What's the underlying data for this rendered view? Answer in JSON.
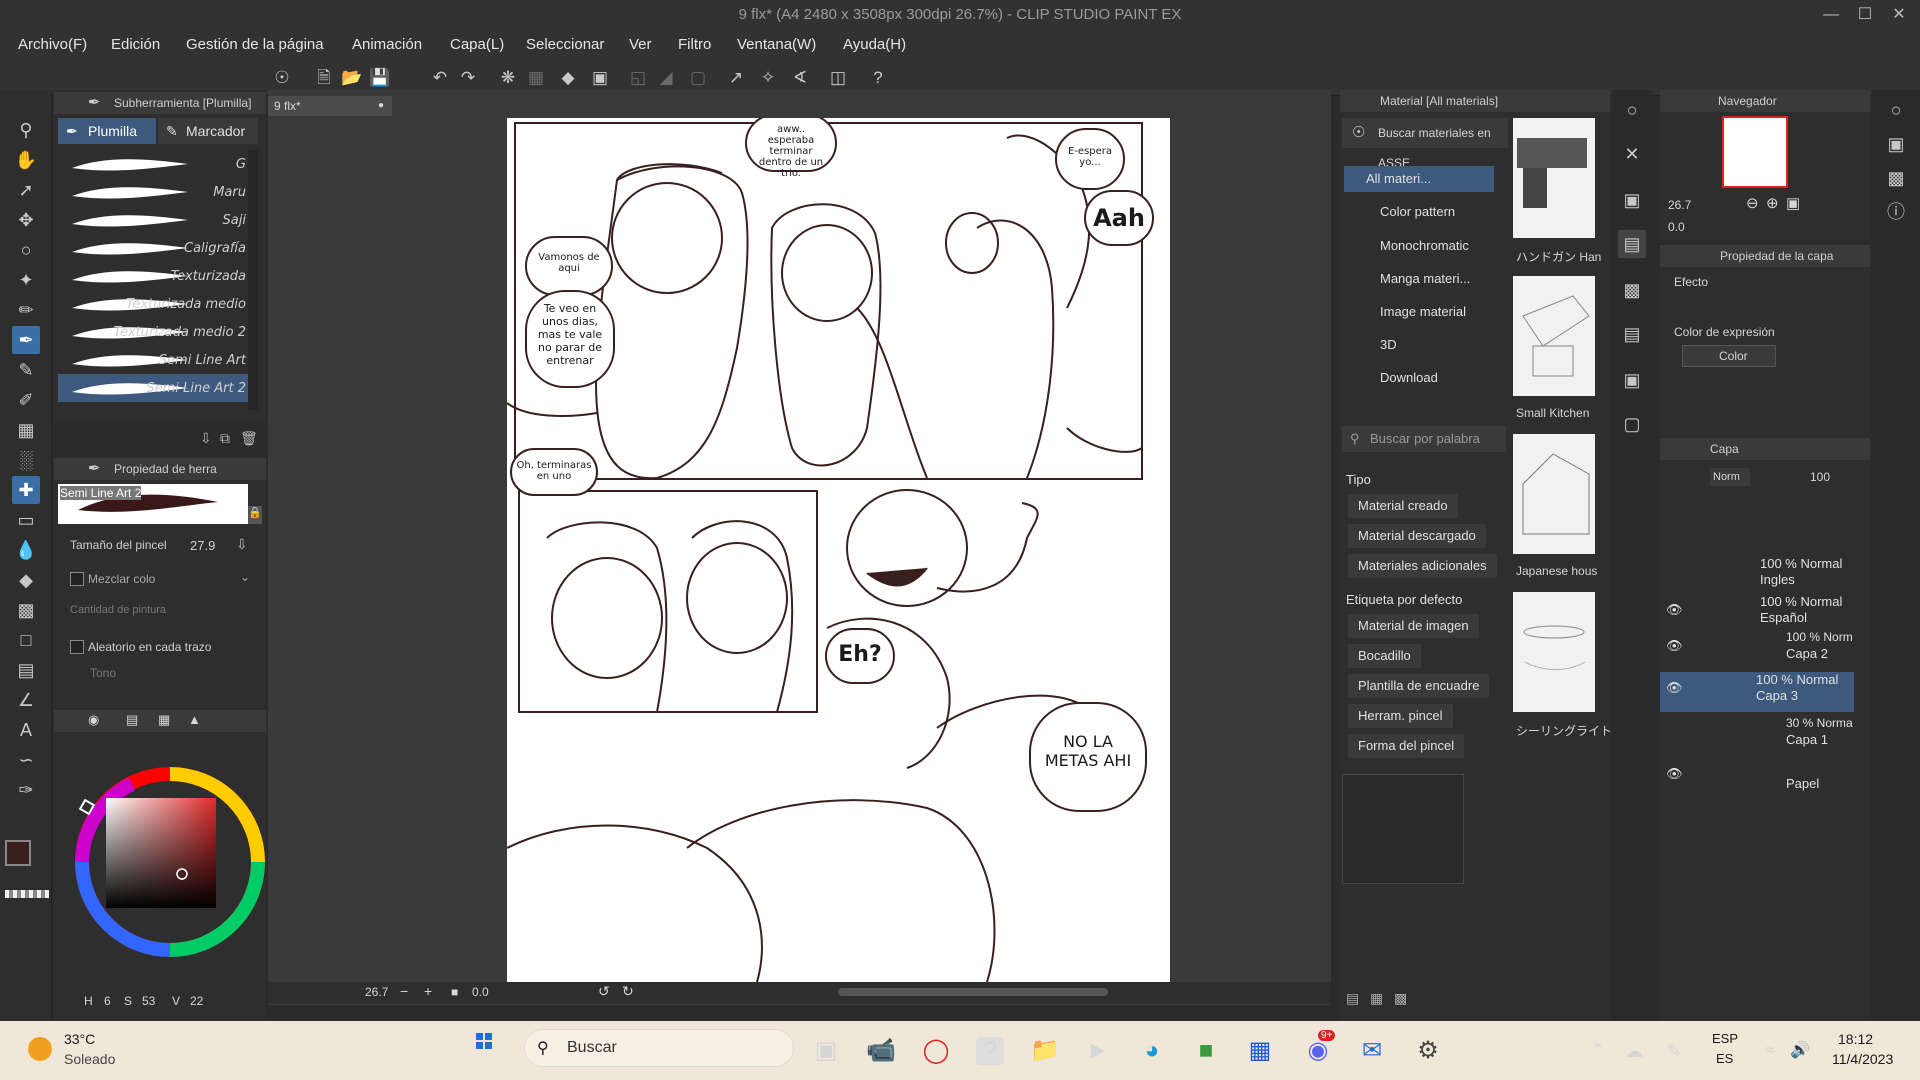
{
  "window": {
    "title": "9 flx* (A4 2480 x 3508px 300dpi 26.7%) - CLIP STUDIO PAINT EX"
  },
  "menu": [
    "Archivo(F)",
    "Edición",
    "Gestión de la página",
    "Animación",
    "Capa(L)",
    "Seleccionar",
    "Ver",
    "Filtro",
    "Ventana(W)",
    "Ayuda(H)"
  ],
  "subtool": {
    "title": "Subherramienta [Plumilla]",
    "tabs": [
      "Plumilla",
      "Marcador"
    ],
    "brushes": [
      "G",
      "Maru",
      "Saji",
      "Caligrafía",
      "Texturizada",
      "Texturizada medio",
      "Texturizada medio 2",
      "Semi Line Art",
      "Semi Line Art 2"
    ]
  },
  "toolprop": {
    "title": "Propiedad de herra",
    "preview_name": "Semi Line Art 2",
    "size_label": "Tamaño del pincel",
    "size_value": "27.9",
    "mix_label": "Mezclar colo",
    "paint_label": "Cantidad de pintura",
    "random_label": "Aleatorio en cada trazo",
    "tone_label": "Tono"
  },
  "color_footer": {
    "h": "H",
    "h_val": "6",
    "s": "S",
    "s_val": "53",
    "v": "V",
    "v_val": "22"
  },
  "document": {
    "tab": "9 flx*"
  },
  "comic": {
    "b1": "aww.. esperaba terminar dentro de un trio.",
    "b2": "E-espera yo...",
    "b3": "Aah",
    "b4": "Vamonos de aqui",
    "b5": "Te veo en unos dias, mas te vale no parar de entrenar",
    "b6": "Oh, terminaras en uno",
    "b7": "Eh?",
    "b8": "NO LA METAS AHI"
  },
  "canvas_status": {
    "zoom": "26.7",
    "angle": "0.0"
  },
  "material": {
    "title": "Material [All materials]",
    "search_assets": "Buscar materiales en ASSE",
    "tree": [
      "All materi...",
      "Color pattern",
      "Monochromatic",
      "Manga materi...",
      "Image material",
      "3D",
      "Download"
    ],
    "search_placeholder": "Buscar por palabra",
    "type_label": "Tipo",
    "types": [
      "Material creado",
      "Material descargado",
      "Materiales adicionales"
    ],
    "tag_label": "Etiqueta por defecto",
    "tags": [
      "Material de imagen",
      "Bocadillo",
      "Plantilla de encuadre",
      "Herram. pincel",
      "Forma del pincel"
    ],
    "thumbs": [
      "ハンドガン Han",
      "Small Kitchen",
      "Japanese hous",
      "シーリングライト"
    ]
  },
  "navigator": {
    "title": "Navegador",
    "zoom": "26.7",
    "angle": "0.0"
  },
  "layer_prop": {
    "title": "Propiedad de la capa",
    "effect_label": "Efecto",
    "expr_label": "Color de expresión",
    "expr_value": "Color"
  },
  "layers": {
    "title": "Capa",
    "blend": "Norm",
    "opacity": "100",
    "items": [
      {
        "line1": "100 % Normal",
        "line2": "Ingles"
      },
      {
        "line1": "100 % Normal",
        "line2": "Español"
      },
      {
        "line1": "100 % Norm",
        "line2": "Capa 2"
      },
      {
        "line1": "100 % Normal",
        "line2": "Capa 3"
      },
      {
        "line1": "30 % Norma",
        "line2": "Capa 1"
      },
      {
        "line1": "",
        "line2": "Papel"
      }
    ]
  },
  "taskbar": {
    "temp": "33°C",
    "weather": "Soleado",
    "search": "Buscar",
    "lang1": "ESP",
    "lang2": "ES",
    "time": "18:12",
    "date": "11/4/2023",
    "badge": "9+"
  }
}
